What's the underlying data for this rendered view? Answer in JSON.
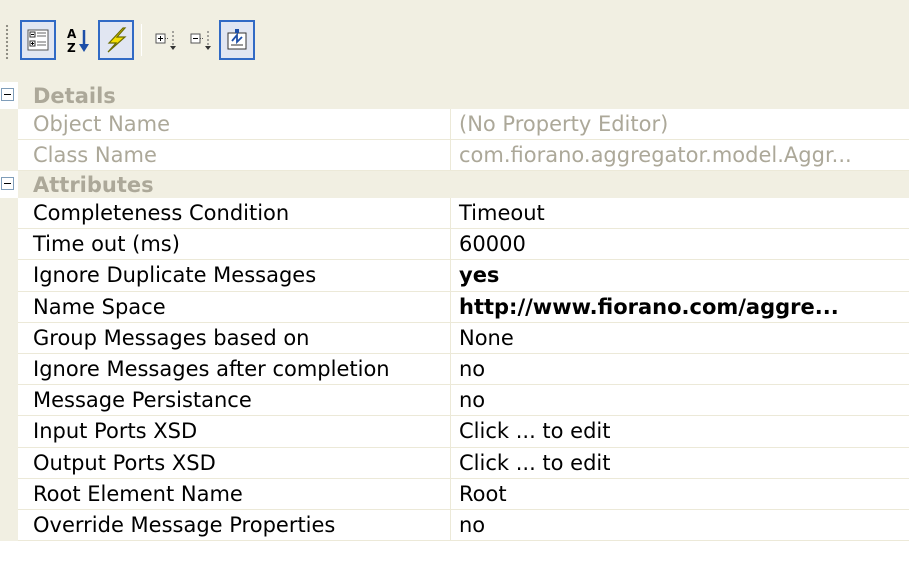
{
  "toolbar": {
    "buttons": [
      {
        "icon": "categorized-icon",
        "checked": true
      },
      {
        "icon": "sort-alphabetical-icon",
        "checked": false
      },
      {
        "icon": "events-lightning-icon",
        "checked": true
      },
      {
        "icon": "expand-all-icon",
        "checked": false
      },
      {
        "icon": "collapse-all-icon",
        "checked": false
      },
      {
        "icon": "property-pages-icon",
        "checked": true
      }
    ]
  },
  "categories": {
    "details": {
      "label": "Details",
      "rows": [
        {
          "name": "Object Name",
          "value": "(No Property Editor)"
        },
        {
          "name": "Class Name",
          "value": "com.fiorano.aggregator.model.Aggr..."
        }
      ]
    },
    "attributes": {
      "label": "Attributes",
      "rows": [
        {
          "name": "Completeness Condition",
          "value": "Timeout"
        },
        {
          "name": "Time out (ms)",
          "value": "60000"
        },
        {
          "name": "Ignore Duplicate Messages",
          "value": "yes"
        },
        {
          "name": "Name Space",
          "value": "http://www.fiorano.com/aggre..."
        },
        {
          "name": "Group Messages based on",
          "value": "None"
        },
        {
          "name": "Ignore Messages after completion",
          "value": "no"
        },
        {
          "name": "Message Persistance",
          "value": "no"
        },
        {
          "name": "Input Ports XSD",
          "value": "Click ... to edit"
        },
        {
          "name": "Output Ports XSD",
          "value": "Click ... to edit"
        },
        {
          "name": "Root Element Name",
          "value": "Root"
        },
        {
          "name": "Override Message Properties",
          "value": "no"
        }
      ]
    }
  }
}
